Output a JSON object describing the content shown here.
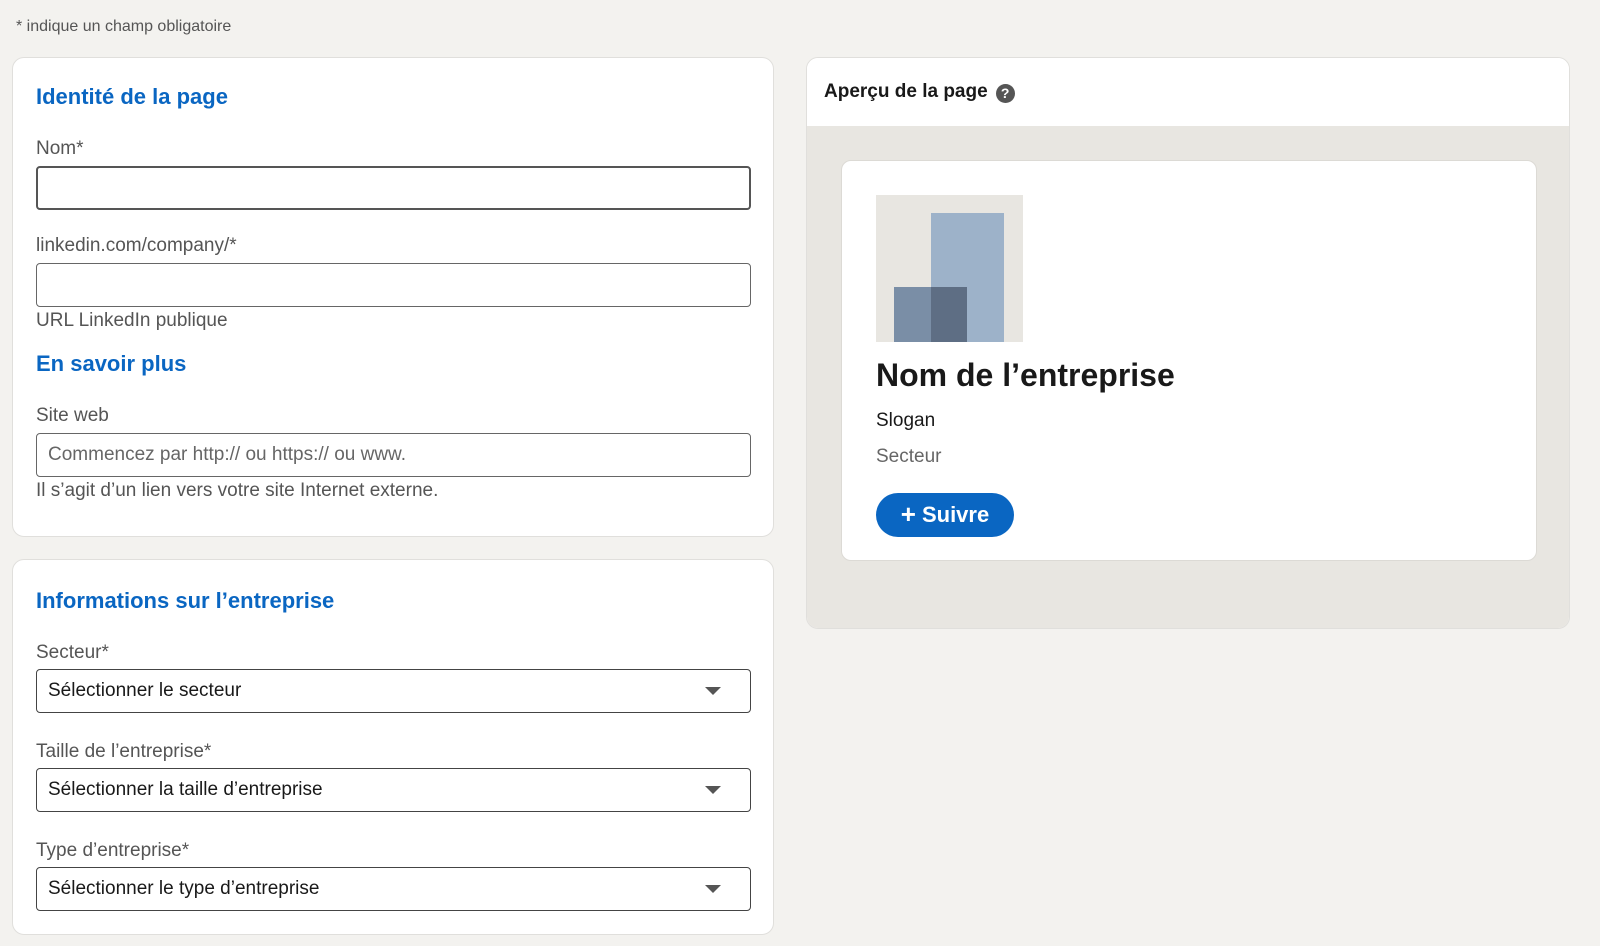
{
  "required_note": "*  indique un champ obligatoire",
  "identity": {
    "title": "Identité de la page",
    "name_label": "Nom*",
    "name_value": "",
    "url_label": "linkedin.com/company/*",
    "url_value": "",
    "url_helper": "URL LinkedIn publique",
    "learn_more": "En savoir plus",
    "website_label": "Site web",
    "website_placeholder": "Commencez par http:// ou https:// ou www.",
    "website_helper": "Il s’agit d’un lien vers votre site Internet externe."
  },
  "company": {
    "title": "Informations sur l’entreprise",
    "industry_label": "Secteur*",
    "industry_value": "Sélectionner le secteur",
    "size_label": "Taille de l’entreprise*",
    "size_value": "Sélectionner la taille d’entreprise",
    "type_label": "Type d’entreprise*",
    "type_value": "Sélectionner le type d’entreprise"
  },
  "preview": {
    "title": "Aperçu de la page",
    "help_icon": "?",
    "company_name": "Nom de l’entreprise",
    "slogan": "Slogan",
    "industry": "Secteur",
    "follow_label": "Suivre",
    "follow_icon": "+"
  },
  "colors": {
    "accent": "#0a66c2",
    "background": "#f3f2ef",
    "preview_background": "#e8e6e1"
  }
}
